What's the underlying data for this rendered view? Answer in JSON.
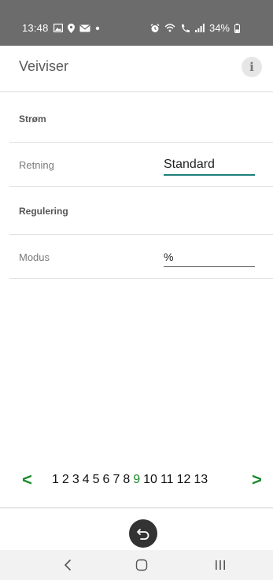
{
  "status_bar": {
    "time": "13:48",
    "battery": "34%",
    "icons_left": [
      "image-icon",
      "location-icon",
      "mail-icon",
      "dot-icon"
    ],
    "icons_right": [
      "alarm-icon",
      "wifi-icon",
      "call-wifi-icon",
      "signal-icon",
      "battery-icon"
    ]
  },
  "app_bar": {
    "title": "Veiviser",
    "info_label": "i"
  },
  "sections": [
    {
      "type": "heading",
      "label": "Strøm"
    },
    {
      "type": "field",
      "label": "Retning",
      "value": "Standard"
    },
    {
      "type": "heading",
      "label": "Regulering"
    },
    {
      "type": "field",
      "label": "Modus",
      "value": "%"
    }
  ],
  "pager": {
    "prev": "<",
    "next": ">",
    "pages": [
      "1",
      "2",
      "3",
      "4",
      "5",
      "6",
      "7",
      "8",
      "9",
      "10",
      "11",
      "12",
      "13"
    ],
    "active_page": "9",
    "active_color": "#1a8a2a"
  },
  "bottom": {
    "undo_icon": "undo-icon"
  },
  "nav_bar": {
    "back_icon": "back-icon",
    "home_icon": "home-icon",
    "recents_icon": "recents-icon"
  }
}
